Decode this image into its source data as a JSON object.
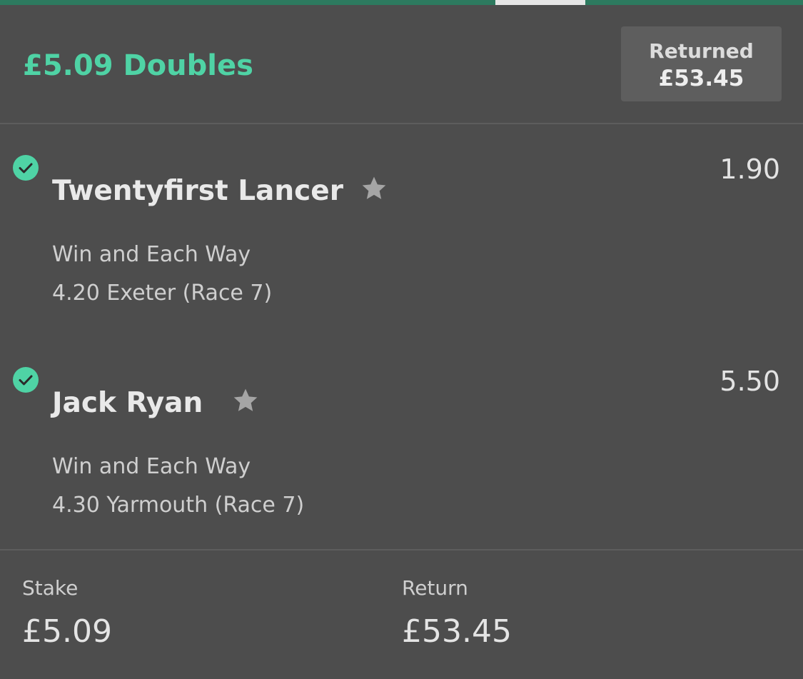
{
  "bet": {
    "title": "£5.09 Doubles",
    "returned_label": "Returned",
    "returned_amount": "£53.45"
  },
  "selections": [
    {
      "name": "Twentyfirst Lancer",
      "odds": "1.90",
      "market": "Win and Each Way",
      "event": "4.20 Exeter (Race 7)",
      "status": "won",
      "favourite_icon": "star-icon",
      "status_icon": "check-circle-icon"
    },
    {
      "name": "Jack Ryan",
      "odds": "5.50",
      "market": "Win and Each Way",
      "event": "4.30 Yarmouth (Race 7)",
      "status": "won",
      "favourite_icon": "star-icon",
      "status_icon": "check-circle-icon"
    }
  ],
  "summary": {
    "stake_label": "Stake",
    "stake_value": "£5.09",
    "return_label": "Return",
    "return_value": "£53.45"
  },
  "colors": {
    "accent": "#4fd3a5",
    "background": "#4d4d4d",
    "panel": "#5e5e5e",
    "tab_strip": "#2d7a5f"
  }
}
